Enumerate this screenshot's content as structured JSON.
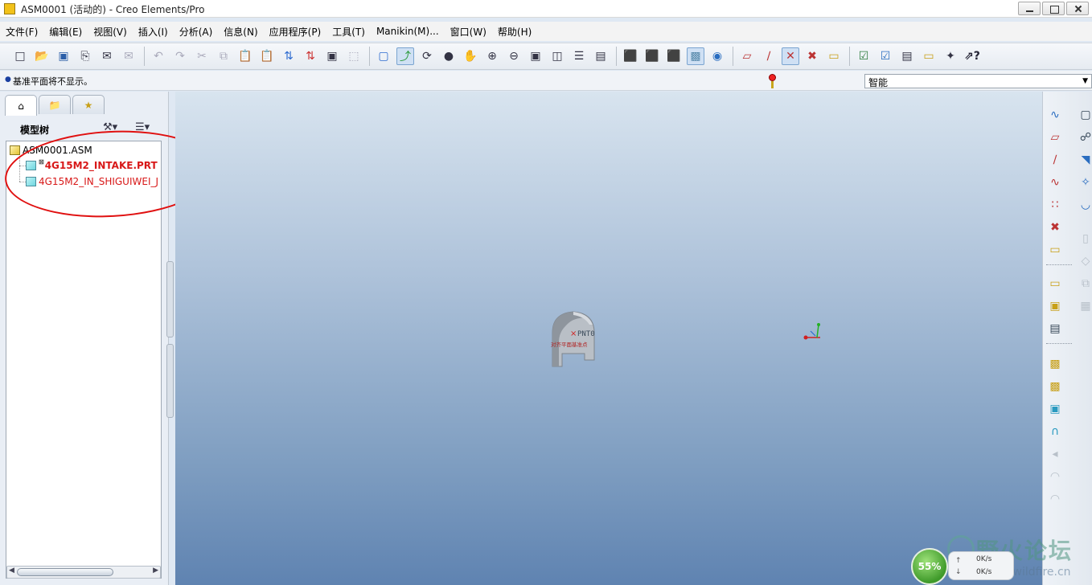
{
  "window": {
    "title": "ASM0001 (活动的) - Creo Elements/Pro",
    "buttons": [
      "minimize",
      "maximize",
      "close"
    ]
  },
  "menu": {
    "items": [
      {
        "label": "文件(F)"
      },
      {
        "label": "编辑(E)"
      },
      {
        "label": "视图(V)"
      },
      {
        "label": "插入(I)"
      },
      {
        "label": "分析(A)"
      },
      {
        "label": "信息(N)"
      },
      {
        "label": "应用程序(P)"
      },
      {
        "label": "工具(T)"
      },
      {
        "label": "Manikin(M)..."
      },
      {
        "label": "窗口(W)"
      },
      {
        "label": "帮助(H)"
      }
    ]
  },
  "toolbar": {
    "icons": [
      "new-icon",
      "open-icon",
      "save-icon",
      "print-icon",
      "email-icon",
      "email-attach-icon",
      "undo-icon",
      "redo-icon",
      "cut-icon",
      "copy-icon",
      "paste-icon",
      "paste-special-icon",
      "regenerate-icon",
      "regen-manager-icon",
      "find-icon",
      "select-box-icon",
      "repaint-icon",
      "spin-center-icon",
      "orient-icon",
      "appearance-icon",
      "pan-icon",
      "zoom-in-icon",
      "zoom-out-icon",
      "refit-icon",
      "reorient-icon",
      "saved-views-icon",
      "layers-icon",
      "wireframe-icon",
      "hidden-line-icon",
      "no-hidden-icon",
      "shading-icon",
      "enhanced-realism-icon",
      "datum-planes-icon",
      "datum-axes-icon",
      "datum-points-icon",
      "csys-icon",
      "annotations-icon",
      "view-manager-icon",
      "model-tree-settings-icon",
      "options-icon",
      "display-icon",
      "context-help-icon"
    ]
  },
  "message": {
    "text": "基准平面将不显示。",
    "filter_value": "智能"
  },
  "left_panel": {
    "tree_label": "模型树",
    "nodes": {
      "root": "ASM0001.ASM",
      "child1": "4G15M2_INTAKE.PRT",
      "child2": "4G15M2_IN_SHIGUIWEI_J"
    }
  },
  "graphics": {
    "point_label": "PNT0",
    "part_note": "对齐平面基准点"
  },
  "widget": {
    "percent": "55%",
    "upload": "0K/s",
    "download": "0K/s"
  },
  "watermark": {
    "text": "野火论坛",
    "url": "proewildfire.cn"
  },
  "colors": {
    "accent_red": "#d81818",
    "graphics_top": "#d8e4ef",
    "graphics_bottom": "#5f83b1",
    "annotation": "#e01010"
  }
}
